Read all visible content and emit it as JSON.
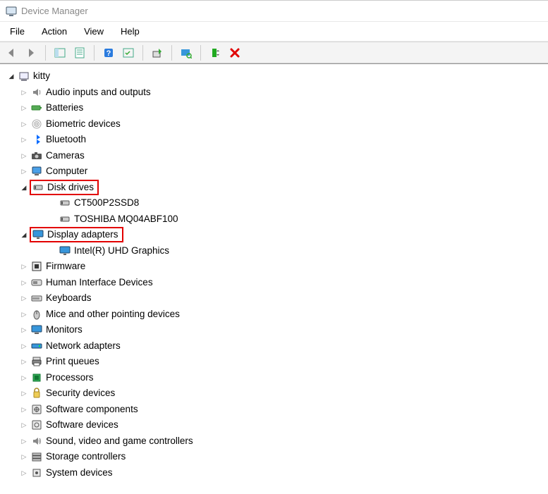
{
  "window": {
    "title": "Device Manager"
  },
  "menubar": [
    "File",
    "Action",
    "View",
    "Help"
  ],
  "tree": {
    "root": {
      "label": "kitty",
      "expanded": true
    },
    "nodes": [
      {
        "label": "Audio inputs and outputs",
        "icon": "speaker",
        "expanded": false,
        "children": []
      },
      {
        "label": "Batteries",
        "icon": "battery",
        "expanded": false,
        "children": []
      },
      {
        "label": "Biometric devices",
        "icon": "fingerprint",
        "expanded": false,
        "children": []
      },
      {
        "label": "Bluetooth",
        "icon": "bluetooth",
        "expanded": false,
        "children": []
      },
      {
        "label": "Cameras",
        "icon": "camera",
        "expanded": false,
        "children": []
      },
      {
        "label": "Computer",
        "icon": "computer",
        "expanded": false,
        "children": []
      },
      {
        "label": "Disk drives",
        "icon": "disk",
        "expanded": true,
        "highlight": true,
        "children": [
          {
            "label": "CT500P2SSD8",
            "icon": "disk"
          },
          {
            "label": "TOSHIBA MQ04ABF100",
            "icon": "disk"
          }
        ]
      },
      {
        "label": "Display adapters",
        "icon": "display",
        "expanded": true,
        "highlight": true,
        "children": [
          {
            "label": "Intel(R) UHD Graphics",
            "icon": "display"
          }
        ]
      },
      {
        "label": "Firmware",
        "icon": "firmware",
        "expanded": false,
        "children": []
      },
      {
        "label": "Human Interface Devices",
        "icon": "hid",
        "expanded": false,
        "children": []
      },
      {
        "label": "Keyboards",
        "icon": "keyboard",
        "expanded": false,
        "children": []
      },
      {
        "label": "Mice and other pointing devices",
        "icon": "mouse",
        "expanded": false,
        "children": []
      },
      {
        "label": "Monitors",
        "icon": "monitor",
        "expanded": false,
        "children": []
      },
      {
        "label": "Network adapters",
        "icon": "network",
        "expanded": false,
        "children": []
      },
      {
        "label": "Print queues",
        "icon": "printer",
        "expanded": false,
        "children": []
      },
      {
        "label": "Processors",
        "icon": "cpu",
        "expanded": false,
        "children": []
      },
      {
        "label": "Security devices",
        "icon": "security",
        "expanded": false,
        "children": []
      },
      {
        "label": "Software components",
        "icon": "swcomp",
        "expanded": false,
        "children": []
      },
      {
        "label": "Software devices",
        "icon": "swdev",
        "expanded": false,
        "children": []
      },
      {
        "label": "Sound, video and game controllers",
        "icon": "sound",
        "expanded": false,
        "children": []
      },
      {
        "label": "Storage controllers",
        "icon": "storage",
        "expanded": false,
        "children": []
      },
      {
        "label": "System devices",
        "icon": "system",
        "expanded": false,
        "children": []
      }
    ]
  }
}
